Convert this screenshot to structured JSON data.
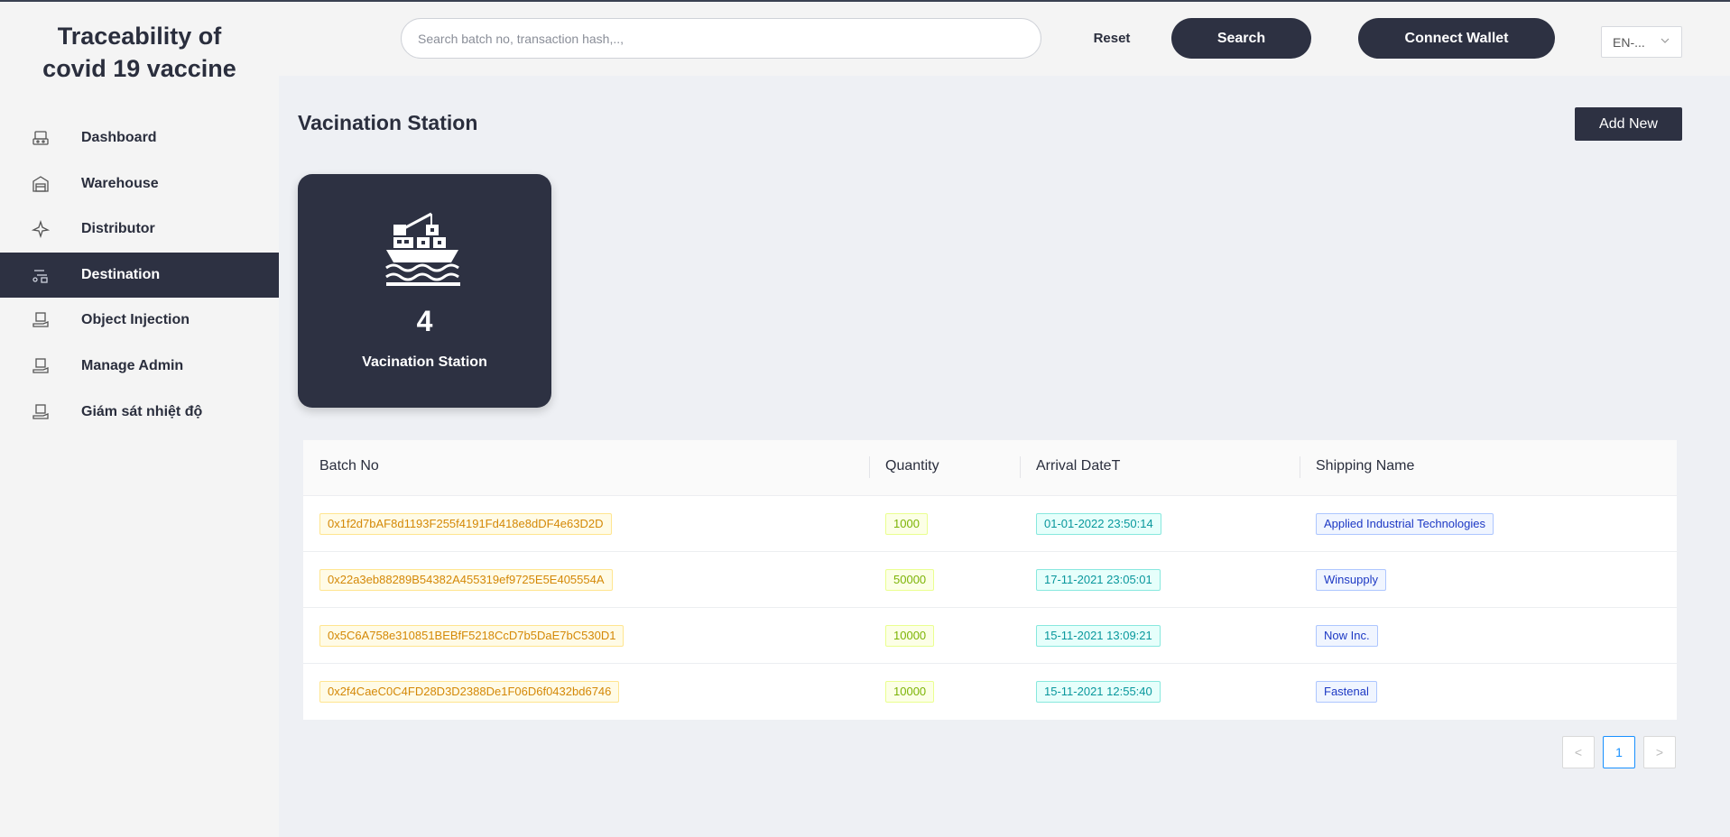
{
  "app": {
    "title_line1": "Traceability of",
    "title_line2": "covid 19 vaccine"
  },
  "sidebar": {
    "items": [
      {
        "label": "Dashboard",
        "icon": "dashboard-icon",
        "active": false
      },
      {
        "label": "Warehouse",
        "icon": "warehouse-icon",
        "active": false
      },
      {
        "label": "Distributor",
        "icon": "distributor-icon",
        "active": false
      },
      {
        "label": "Destination",
        "icon": "destination-icon",
        "active": true
      },
      {
        "label": "Object Injection",
        "icon": "object-injection-icon",
        "active": false
      },
      {
        "label": "Manage Admin",
        "icon": "manage-admin-icon",
        "active": false
      },
      {
        "label": "Giám sát nhiệt độ",
        "icon": "temperature-monitor-icon",
        "active": false
      }
    ]
  },
  "header": {
    "search_placeholder": "Search batch no, transaction hash,..,",
    "reset_label": "Reset",
    "search_label": "Search",
    "wallet_label": "Connect Wallet",
    "language": "EN-..."
  },
  "main": {
    "page_title": "Vacination Station",
    "add_label": "Add New",
    "stat": {
      "value": "4",
      "caption": "Vacination Station",
      "icon": "cargo-ship-icon"
    }
  },
  "table": {
    "columns": [
      "Batch No",
      "Quantity",
      "Arrival DateT",
      "Shipping Name"
    ],
    "rows": [
      {
        "batch": "0x1f2d7bAF8d1193F255f4191Fd418e8dDF4e63D2D",
        "qty": "1000",
        "date": "01-01-2022 23:50:14",
        "ship": "Applied Industrial Technologies"
      },
      {
        "batch": "0x22a3eb88289B54382A455319ef9725E5E405554A",
        "qty": "50000",
        "date": "17-11-2021 23:05:01",
        "ship": "Winsupply"
      },
      {
        "batch": "0x5C6A758e310851BEBfF5218CcD7b5DaE7bC530D1",
        "qty": "10000",
        "date": "15-11-2021 13:09:21",
        "ship": "Now Inc."
      },
      {
        "batch": "0x2f4CaeC0C4FD28D3D2388De1F06D6f0432bd6746",
        "qty": "10000",
        "date": "15-11-2021 12:55:40",
        "ship": "Fastenal"
      }
    ]
  },
  "pagination": {
    "prev": "<",
    "current": "1",
    "next": ">"
  },
  "colors": {
    "primary": "#2d3142",
    "batch_tag": "#d48806",
    "qty_tag": "#7cb305",
    "date_tag": "#08979c",
    "ship_tag": "#1d39c4",
    "pagination_active": "#1890ff"
  }
}
